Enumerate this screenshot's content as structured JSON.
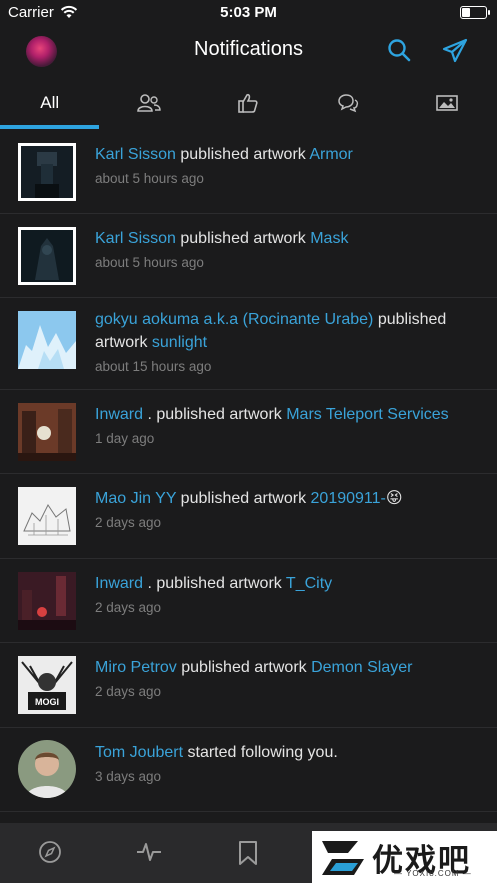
{
  "status_bar": {
    "carrier": "Carrier",
    "time": "5:03 PM"
  },
  "nav": {
    "title": "Notifications"
  },
  "tabs": [
    {
      "label": "All",
      "icon": null
    },
    {
      "label": null,
      "icon": "people-icon"
    },
    {
      "label": null,
      "icon": "thumbs-up-icon"
    },
    {
      "label": null,
      "icon": "comments-icon"
    },
    {
      "label": null,
      "icon": "image-icon"
    }
  ],
  "notifications": [
    {
      "user": "Karl Sisson",
      "action": " published artwork ",
      "target": "Armor",
      "time": "about 5 hours ago"
    },
    {
      "user": "Karl Sisson",
      "action": " published artwork ",
      "target": "Mask",
      "time": "about 5 hours ago"
    },
    {
      "user": "gokyu aokuma a.k.a (Rocinante Urabe)",
      "action": " published artwork ",
      "target": "sunlight",
      "time": "about 15 hours ago"
    },
    {
      "user": "Inward",
      "action": " . published artwork ",
      "target": "Mars Teleport Services",
      "time": "1 day ago"
    },
    {
      "user": "Mao Jin  YY",
      "action": " published artwork ",
      "target": "20190911-",
      "emoji": "😝",
      "time": "2 days ago"
    },
    {
      "user": "Inward",
      "action": " . published artwork ",
      "target": "T_City",
      "time": "2 days ago"
    },
    {
      "user": "Miro Petrov",
      "action": " published artwork ",
      "target": "Demon Slayer",
      "time": "2 days ago"
    },
    {
      "user": "Tom Joubert",
      "action": " started following you.",
      "target": "",
      "time": "3 days ago"
    }
  ],
  "thumb_text": {
    "mogi": "MOGI"
  },
  "bottom_tabs": [
    "compass-icon",
    "activity-icon",
    "bookmark-icon"
  ],
  "watermark": {
    "cn": "优戏吧",
    "url": "— YOXI8.COM —"
  },
  "colors": {
    "accent": "#2ea4e0",
    "link": "#3aa3d9",
    "background": "#1b1b1c"
  }
}
